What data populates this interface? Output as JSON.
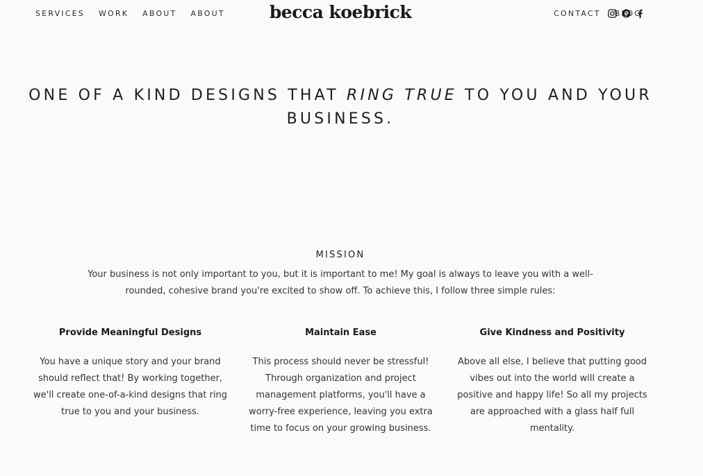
{
  "nav": {
    "left": [
      "SERVICES",
      "WORK",
      "ABOUT",
      "ABOUT"
    ],
    "right": [
      "CONTACT",
      "BLOG"
    ]
  },
  "logo": "becca koebrick",
  "social": [
    "instagram-icon",
    "pinterest-icon",
    "facebook-icon"
  ],
  "hero": {
    "before": "ONE OF A KIND DESIGNS THAT ",
    "emphasis": "RING TRUE",
    "after": " TO YOU AND YOUR BUSINESS."
  },
  "mission": {
    "title": "MISSION",
    "text": "Your business is not only important to you, but it is important to me! My goal is always to leave you with a well-rounded, cohesive brand you're excited to show off. To achieve this, I follow three simple rules:"
  },
  "rules": [
    {
      "title": "Provide Meaningful Designs",
      "text": "You have a unique story and your brand should reflect that! By working together, we'll create one-of-a-kind designs that ring true to you and your business."
    },
    {
      "title": "Maintain Ease",
      "text": "This process should never be stressful! Through organization and project management platforms, you'll have a worry-free experience, leaving you extra time to focus on your growing business."
    },
    {
      "title": "Give Kindness and Positivity",
      "text": "Above all else, I believe that putting good vibes out into the world will create a positive and happy life! So all my projects are approached with a glass half full mentality."
    }
  ]
}
